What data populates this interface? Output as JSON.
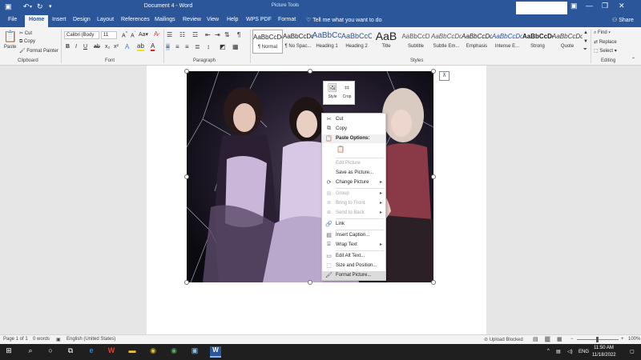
{
  "title_bar": {
    "document_title": "Document 4  -  Word",
    "context_title": "Picture Tools",
    "icons": [
      "word-save-icon",
      "undo-icon",
      "redo-icon",
      "customize-qat-icon"
    ],
    "window_controls": [
      "ribbon-display-icon",
      "minimize-icon",
      "restore-icon",
      "close-icon"
    ]
  },
  "tabs": [
    "File",
    "Home",
    "Insert",
    "Design",
    "Layout",
    "References",
    "Mailings",
    "Review",
    "View",
    "Help",
    "WPS PDF",
    "Format"
  ],
  "active_tab": "Home",
  "tell_me": "Tell me what you want to do",
  "share": "Share",
  "ribbon": {
    "clipboard": {
      "paste": "Paste",
      "cut": "Cut",
      "copy": "Copy",
      "format_painter": "Format Painter",
      "label": "Clipboard"
    },
    "font": {
      "font_name": "Calibri (Body",
      "font_size": "11",
      "label": "Font"
    },
    "paragraph": {
      "label": "Paragraph"
    },
    "styles": {
      "label": "Styles",
      "items": [
        {
          "sample": "AaBbCcDd",
          "name": "¶ Normal"
        },
        {
          "sample": "AaBbCcDd",
          "name": "¶ No Spac..."
        },
        {
          "sample": "AaBbCc",
          "name": "Heading 1"
        },
        {
          "sample": "AaBbCcC",
          "name": "Heading 2"
        },
        {
          "sample": "AaB",
          "name": "Title"
        },
        {
          "sample": "AaBbCcD",
          "name": "Subtitle"
        },
        {
          "sample": "AaBbCcDd",
          "name": "Subtle Em..."
        },
        {
          "sample": "AaBbCcDd",
          "name": "Emphasis"
        },
        {
          "sample": "AaBbCcDd",
          "name": "Intense E..."
        },
        {
          "sample": "AaBbCcDc",
          "name": "Strong"
        },
        {
          "sample": "AaBbCcDd",
          "name": "Quote"
        }
      ]
    },
    "editing": {
      "find": "Find",
      "replace": "Replace",
      "select": "Select",
      "label": "Editing"
    }
  },
  "mini_toolbar": {
    "style": "Style",
    "crop": "Crop"
  },
  "context_menu": [
    {
      "label": "Cut",
      "icon": "scissors-icon",
      "state": "enabled"
    },
    {
      "label": "Copy",
      "icon": "copy-icon",
      "state": "enabled"
    },
    {
      "label": "Paste Options:",
      "icon": "paste-icon",
      "state": "header"
    },
    {
      "label": "",
      "icon": "paste-option-icon",
      "state": "option"
    },
    {
      "label": "Edit Picture",
      "icon": "",
      "state": "disabled"
    },
    {
      "label": "Save as Picture...",
      "icon": "",
      "state": "enabled"
    },
    {
      "label": "Change Picture",
      "icon": "change-picture-icon",
      "state": "submenu"
    },
    {
      "label": "Group",
      "icon": "group-icon",
      "state": "disabled-submenu"
    },
    {
      "label": "Bring to Front",
      "icon": "bring-front-icon",
      "state": "disabled-submenu"
    },
    {
      "label": "Send to Back",
      "icon": "send-back-icon",
      "state": "disabled-submenu"
    },
    {
      "label": "Link",
      "icon": "link-icon",
      "state": "enabled"
    },
    {
      "label": "Insert Caption...",
      "icon": "caption-icon",
      "state": "enabled"
    },
    {
      "label": "Wrap Text",
      "icon": "wrap-text-icon",
      "state": "submenu"
    },
    {
      "label": "Edit Alt Text...",
      "icon": "alt-text-icon",
      "state": "enabled"
    },
    {
      "label": "Size and Position...",
      "icon": "size-position-icon",
      "state": "enabled"
    },
    {
      "label": "Format Picture...",
      "icon": "format-picture-icon",
      "state": "highlighted"
    }
  ],
  "status_bar": {
    "page": "Page 1 of 1",
    "words": "0 words",
    "language": "English (United States)",
    "upload": "Upload Blocked",
    "zoom": "100%"
  },
  "taskbar": {
    "apps": [
      "windows-start-icon",
      "search-icon",
      "task-view-icon",
      "widgets-icon",
      "edge-icon",
      "wps-icon",
      "file-explorer-icon",
      "chrome-icon",
      "chrome-alt-icon",
      "notepad-icon",
      "word-icon"
    ],
    "language": "ENG",
    "time": "11:50 AM",
    "date": "11/18/2022"
  },
  "colors": {
    "word_blue": "#2b579a",
    "ribbon": "#f3f3f3",
    "workspace": "#e6e6e6",
    "taskbar": "#1f1f1f"
  }
}
